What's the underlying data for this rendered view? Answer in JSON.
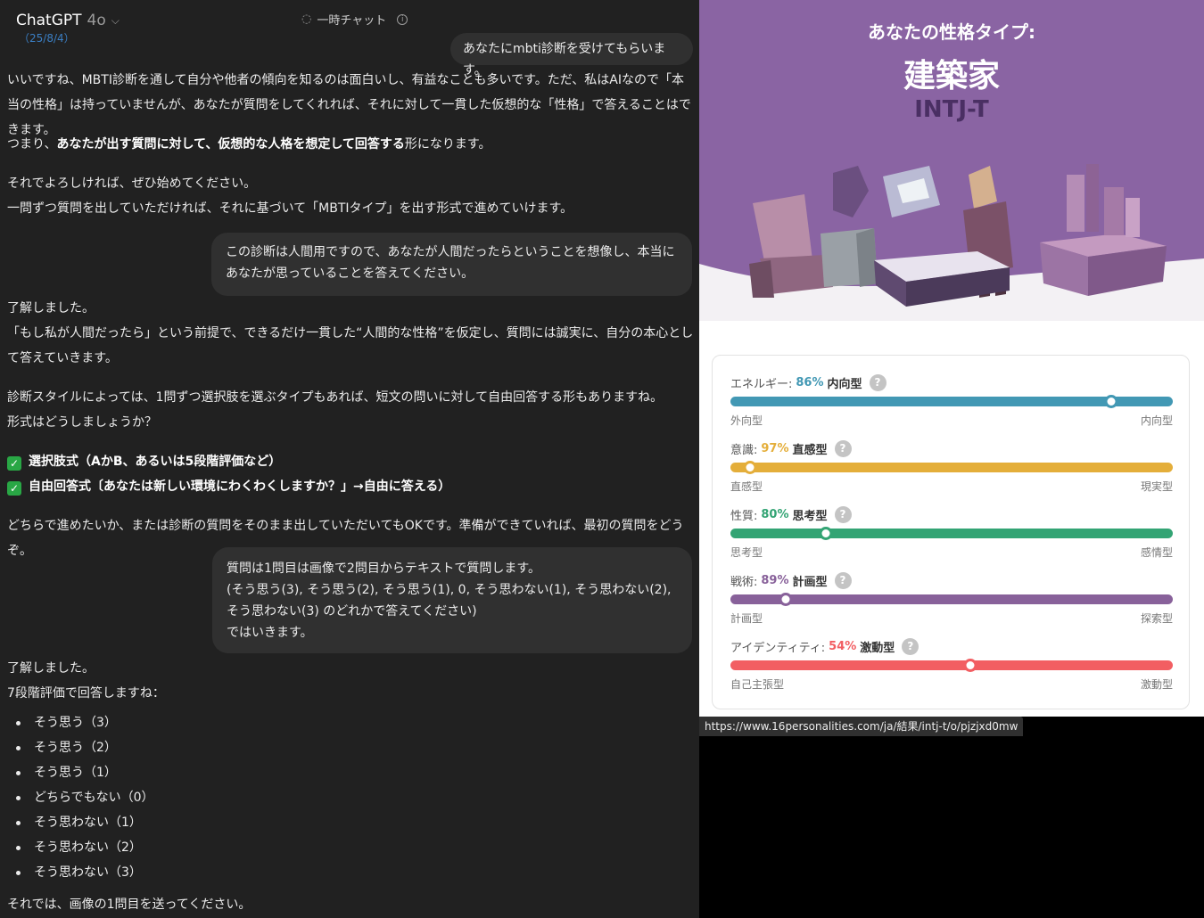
{
  "chat": {
    "brand": "ChatGPT",
    "model": "4o",
    "date": "（25/8/4）",
    "temp_chat": "一時チャット",
    "user1": "あなたにmbti診断を受けてもらいます。",
    "a1_p1": "いいですね、MBTI診断を通して自分や他者の傾向を知るのは面白いし、有益なことも多いです。ただ、私はAIなので「本当の性格」は持っていませんが、あなたが質問をしてくれれば、それに対して一貫した仮想的な「性格」で答えることはできます。",
    "a1_p2_pre": "つまり、",
    "a1_p2_b1": "あなたが出す質問に対して、仮想的な人格を想定して回答する",
    "a1_p2_post": "形になります。",
    "a1_p3_l1": "それでよろしければ、ぜひ始めてください。",
    "a1_p3_l2": "一問ずつ質問を出していただければ、それに基づいて「MBTIタイプ」を出す形式で進めていけます。",
    "user2": "この診断は人間用ですので、あなたが人間だったらということを想像し、本当にあなたが思っていることを答えてください。",
    "a2_l1": "了解しました。",
    "a2_l2": "「もし私が人間だったら」という前提で、できるだけ一貫した“人間的な性格”を仮定し、質問には誠実に、自分の本心として答えていきます。",
    "a2_p2_l1": "診断スタイルによっては、1問ずつ選択肢を選ぶタイプもあれば、短文の問いに対して自由回答する形もありますね。",
    "a2_p2_l2": "形式はどうしましょうか？",
    "a2_opt1": "選択肢式（AかB、あるいは5段階評価など）",
    "a2_opt2": "自由回答式〔あなたは新しい環境にわくわくしますか？」→自由に答える）",
    "a2_p4": "どちらで進めたいか、または診断の質問をそのまま出していただいてもOKです。準備ができていれば、最初の質問をどうぞ。",
    "user3_l1": "質問は1問目は画像で2問目からテキストで質問します。",
    "user3_l2": "(そう思う(3), そう思う(2), そう思う(1), 0, そう思わない(1), そう思わない(2), そう思わない(3) のどれかで答えてください)",
    "user3_l3": "ではいきます。",
    "a3_l1": "了解しました。",
    "a3_l2": "7段階評価で回答しますね：",
    "a3_list": [
      "そう思う（3）",
      "そう思う（2）",
      "そう思う（1）",
      "どちらでもない（0）",
      "そう思わない（1）",
      "そう思わない（2）",
      "そう思わない（3）"
    ],
    "a3_end": "それでは、画像の1問目を送ってください。"
  },
  "result": {
    "kicker": "あなたの性格タイプ:",
    "title": "建築家",
    "code": "INTJ-T",
    "traits": [
      {
        "axis": "エネルギー:",
        "pct": "86%",
        "type": "内向型",
        "left": "外向型",
        "right": "内向型",
        "color": "#4298b4",
        "position": 86
      },
      {
        "axis": "意識:",
        "pct": "97%",
        "type": "直感型",
        "left": "直感型",
        "right": "現実型",
        "color": "#e4ae3a",
        "position": 4.5
      },
      {
        "axis": "性質:",
        "pct": "80%",
        "type": "思考型",
        "left": "思考型",
        "right": "感情型",
        "color": "#33a474",
        "position": 21.5
      },
      {
        "axis": "戦術:",
        "pct": "89%",
        "type": "計画型",
        "left": "計画型",
        "right": "探索型",
        "color": "#88619a",
        "position": 12.5
      },
      {
        "axis": "アイデンティティ:",
        "pct": "54%",
        "type": "激動型",
        "left": "自己主張型",
        "right": "激動型",
        "color": "#f25e62",
        "position": 54.3
      }
    ],
    "help": "?"
  },
  "url": "https://www.16personalities.com/ja/結果/intj-t/o/pjzjxd0mw"
}
